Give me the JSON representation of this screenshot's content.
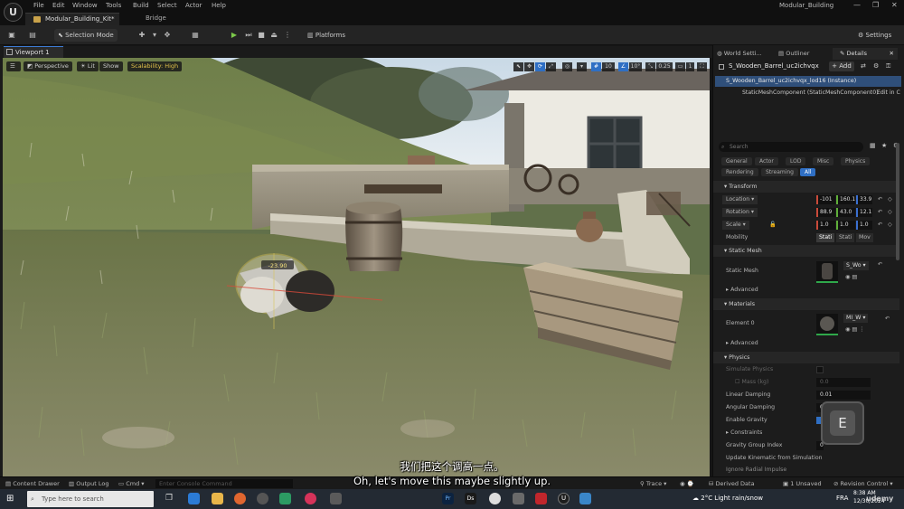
{
  "menubar": {
    "items": [
      "File",
      "Edit",
      "Window",
      "Tools",
      "Build",
      "Select",
      "Actor",
      "Help"
    ],
    "project_tab": "Modular_Building_Kit*",
    "bridge_tab": "Bridge",
    "window_title": "Modular_Building"
  },
  "toolbar": {
    "selection_mode": "Selection Mode",
    "platforms": "Platforms",
    "settings": "Settings"
  },
  "viewport": {
    "tab": "Viewport 1",
    "perspective": "Perspective",
    "lit": "Lit",
    "show": "Show",
    "scalability": "Scalability: High",
    "grid_snap": "10",
    "rot_snap": "10°",
    "scale_snap": "0.25",
    "cam_speed": "1",
    "rotation_readout": "-23.90"
  },
  "panel_tabs": [
    "World Setti...",
    "Outliner",
    "Details"
  ],
  "details": {
    "actor_name": "S_Wooden_Barrel_uc2ichvqx",
    "add_label": "+ Add",
    "instance_label": "S_Wooden_Barrel_uc2ichvqx_lod16 (Instance)",
    "component_label": "StaticMeshComponent (StaticMeshComponent0)",
    "edit_link": "Edit in C",
    "search_placeholder": "Search",
    "chips_row1": [
      "General",
      "Actor",
      "LOD",
      "Misc",
      "Physics"
    ],
    "chips_row2": [
      "Rendering",
      "Streaming",
      "All"
    ],
    "transform_header": "Transform",
    "location_label": "Location",
    "location": [
      "-101",
      "160.1",
      "33.9"
    ],
    "rotation_label": "Rotation",
    "rotation": [
      "88.9",
      "43.0",
      "12.1"
    ],
    "scale_label": "Scale",
    "scale": [
      "1.0",
      "1.0",
      "1.0"
    ],
    "mobility_label": "Mobility",
    "mobility": [
      "Stati",
      "Stati",
      "Mov"
    ],
    "static_mesh_header": "Static Mesh",
    "static_mesh_label": "Static Mesh",
    "static_mesh_value": "S_Wo",
    "advanced": "Advanced",
    "materials_header": "Materials",
    "element_label": "Element 0",
    "element_value": "MI_W",
    "physics_header": "Physics",
    "simulate_physics": "Simulate Physics",
    "mass_kg": "Mass (kg)",
    "mass_value": "0.0",
    "linear_damping": "Linear Damping",
    "linear_damping_value": "0.01",
    "angular_damping": "Angular Damping",
    "angular_damping_value": "0.0",
    "enable_gravity": "Enable Gravity",
    "constraints": "Constraints",
    "gravity_group_index": "Gravity Group Index",
    "gravity_group_value": "0",
    "update_kinematic": "Update Kinematic from Simulation",
    "ignore_radial": "Ignore Radial Impulse"
  },
  "statusbar": {
    "content_drawer": "Content Drawer",
    "output_log": "Output Log",
    "cmd": "Cmd",
    "console_placeholder": "Enter Console Command",
    "trace": "Trace",
    "derived_data": "Derived Data",
    "unsaved": "1 Unsaved",
    "revision_control": "Revision Control"
  },
  "taskbar": {
    "search_placeholder": "Type here to search",
    "weather": "2°C  Light rain/snow",
    "language": "FRA",
    "time": "8:38 AM",
    "date": "12/30/2024",
    "watermark": "udemy"
  },
  "subtitles": {
    "zh": "我们把这个调高一点。",
    "en": "Oh, let's move this maybe slightly up."
  },
  "key_overlay": "E"
}
